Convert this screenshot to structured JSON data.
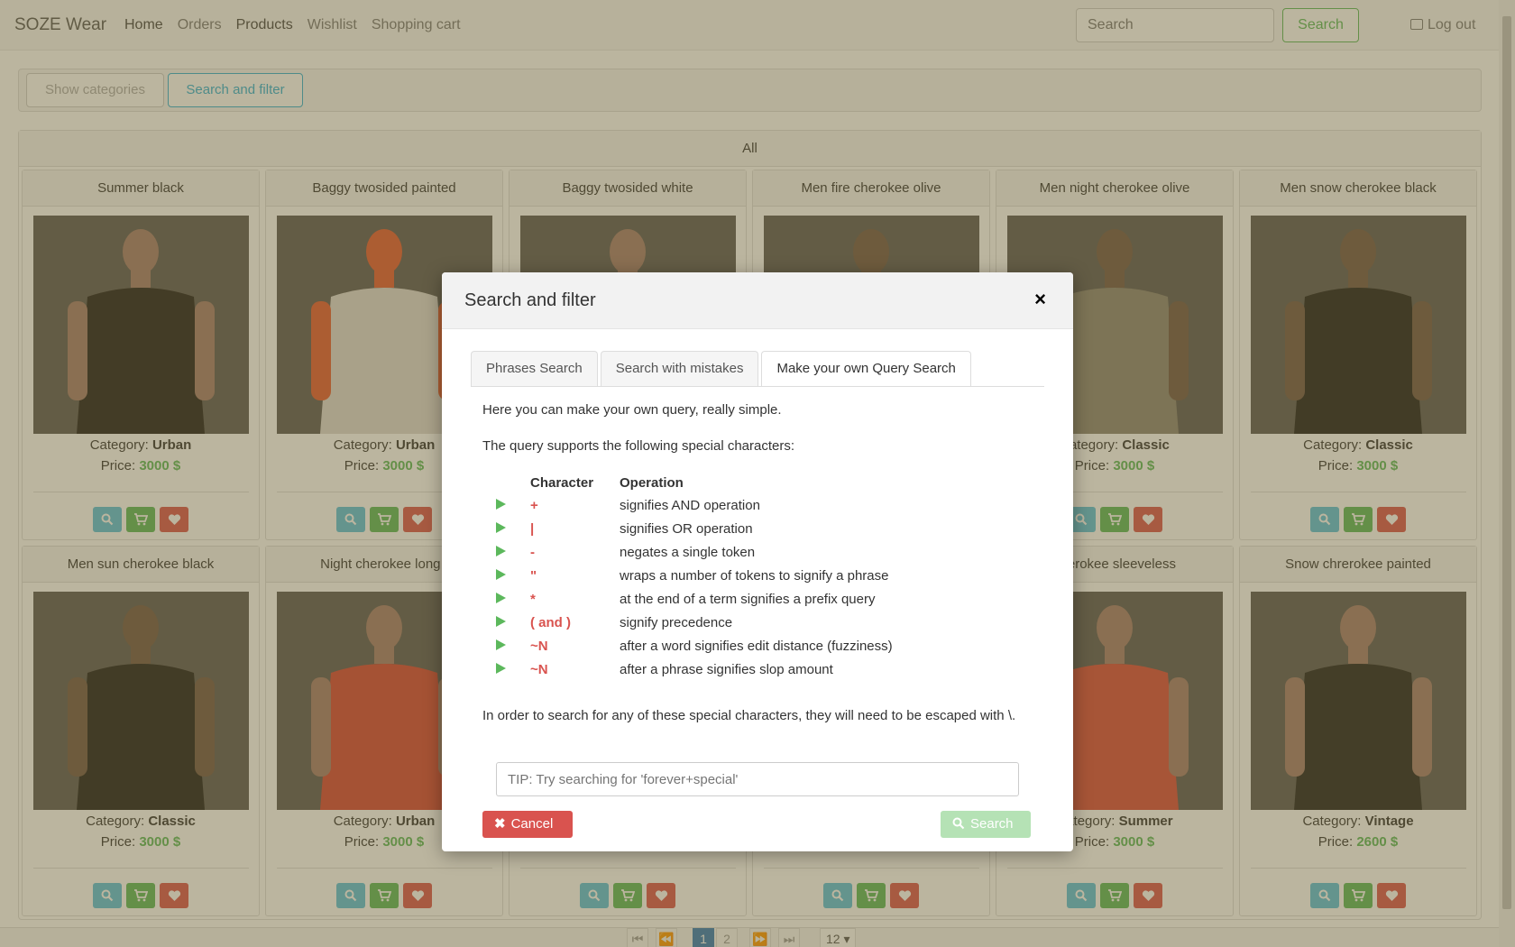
{
  "navbar": {
    "brand": "SOZE Wear",
    "links": [
      "Home",
      "Orders",
      "Products",
      "Wishlist",
      "Shopping cart"
    ],
    "search_placeholder": "Search",
    "search_button": "Search",
    "logout": "Log out"
  },
  "filter_bar": {
    "show_categories": "Show categories",
    "search_and_filter": "Search and filter"
  },
  "products_panel": {
    "heading": "All",
    "category_label": "Category:",
    "price_label": "Price:",
    "products": [
      {
        "title": "Summer black",
        "category": "Urban",
        "price": "3000 $",
        "image_colors": [
          "#5a5855",
          "#1e1c1c",
          "#a37c6e"
        ]
      },
      {
        "title": "Baggy twosided painted",
        "category": "Urban",
        "price": "3000 $",
        "image_colors": [
          "#5a5855",
          "#dddad6",
          "#e35a32"
        ]
      },
      {
        "title": "Baggy twosided white",
        "category": "",
        "price": "",
        "image_colors": [
          "#5a5855",
          "#f2f2f0",
          "#a37c6e"
        ]
      },
      {
        "title": "Men fire cherokee olive",
        "category": "",
        "price": "",
        "image_colors": [
          "#5a5855",
          "#7d7a6d",
          "#6e5546"
        ]
      },
      {
        "title": "Men night cherokee olive",
        "category": "Classic",
        "price": "3000 $",
        "image_colors": [
          "#5a5855",
          "#8a8575",
          "#6e5546"
        ]
      },
      {
        "title": "Men snow cherokee black",
        "category": "Classic",
        "price": "3000 $",
        "image_colors": [
          "#5a5855",
          "#1c1c1c",
          "#6e5546"
        ]
      },
      {
        "title": "Men sun cherokee black",
        "category": "Classic",
        "price": "3000 $",
        "image_colors": [
          "#5a5855",
          "#1c1c1c",
          "#6e5546"
        ]
      },
      {
        "title": "Night cherokee long t",
        "category": "Urban",
        "price": "3000 $",
        "image_colors": [
          "#5a5855",
          "#d64536",
          "#a37c6e"
        ]
      },
      {
        "title": "",
        "category": "",
        "price": "",
        "image_colors": [
          "#5a5855",
          "#d8d4cf",
          "#a37c6e"
        ]
      },
      {
        "title": "",
        "category": "",
        "price": "",
        "image_colors": [
          "#5a5855",
          "#d8d4cf",
          "#6e5546"
        ]
      },
      {
        "title": "cherokee sleeveless",
        "category": "Summer",
        "price": "3000 $",
        "image_colors": [
          "#5a5855",
          "#d94a3b",
          "#a37c6e"
        ]
      },
      {
        "title": "Snow chrerokee painted",
        "category": "Vintage",
        "price": "2600 $",
        "image_colors": [
          "#5a5855",
          "#1f1f1f",
          "#a37c6e"
        ]
      }
    ]
  },
  "pagination": {
    "pages": [
      "1",
      "2"
    ],
    "current_page": "1",
    "page_size": "12 ▾"
  },
  "modal": {
    "title": "Search and filter",
    "close": "×",
    "tabs": [
      "Phrases Search",
      "Search with mistakes",
      "Make your own Query Search"
    ],
    "active_tab": "Make your own Query Search",
    "intro": "Here you can make your own query, really simple.",
    "supports": "The query supports the following special characters:",
    "table_headers": {
      "character": "Character",
      "operation": "Operation"
    },
    "special_chars": [
      {
        "char": "+",
        "op": "signifies AND operation"
      },
      {
        "char": "|",
        "op": "signifies OR operation"
      },
      {
        "char": "-",
        "op": "negates a single token"
      },
      {
        "char": "\"",
        "op": "wraps a number of tokens to signify a phrase"
      },
      {
        "char": "*",
        "op": "at the end of a term signifies a prefix query"
      },
      {
        "char": "( and )",
        "op": "signify precedence"
      },
      {
        "char": "~N",
        "op": "after a word signifies edit distance (fuzziness)"
      },
      {
        "char": "~N",
        "op": "after a phrase signifies slop amount"
      }
    ],
    "escape_note": "In order to search for any of these special characters, they will need to be escaped with \\.",
    "query_placeholder": "TIP: Try searching for 'forever+special'",
    "cancel": "Cancel",
    "search": "Search"
  },
  "colors": {
    "overlay": "#6e6232",
    "success": "#5cb85c",
    "danger": "#d9534f",
    "info": "#5bc0de",
    "primary": "#337ab7"
  }
}
